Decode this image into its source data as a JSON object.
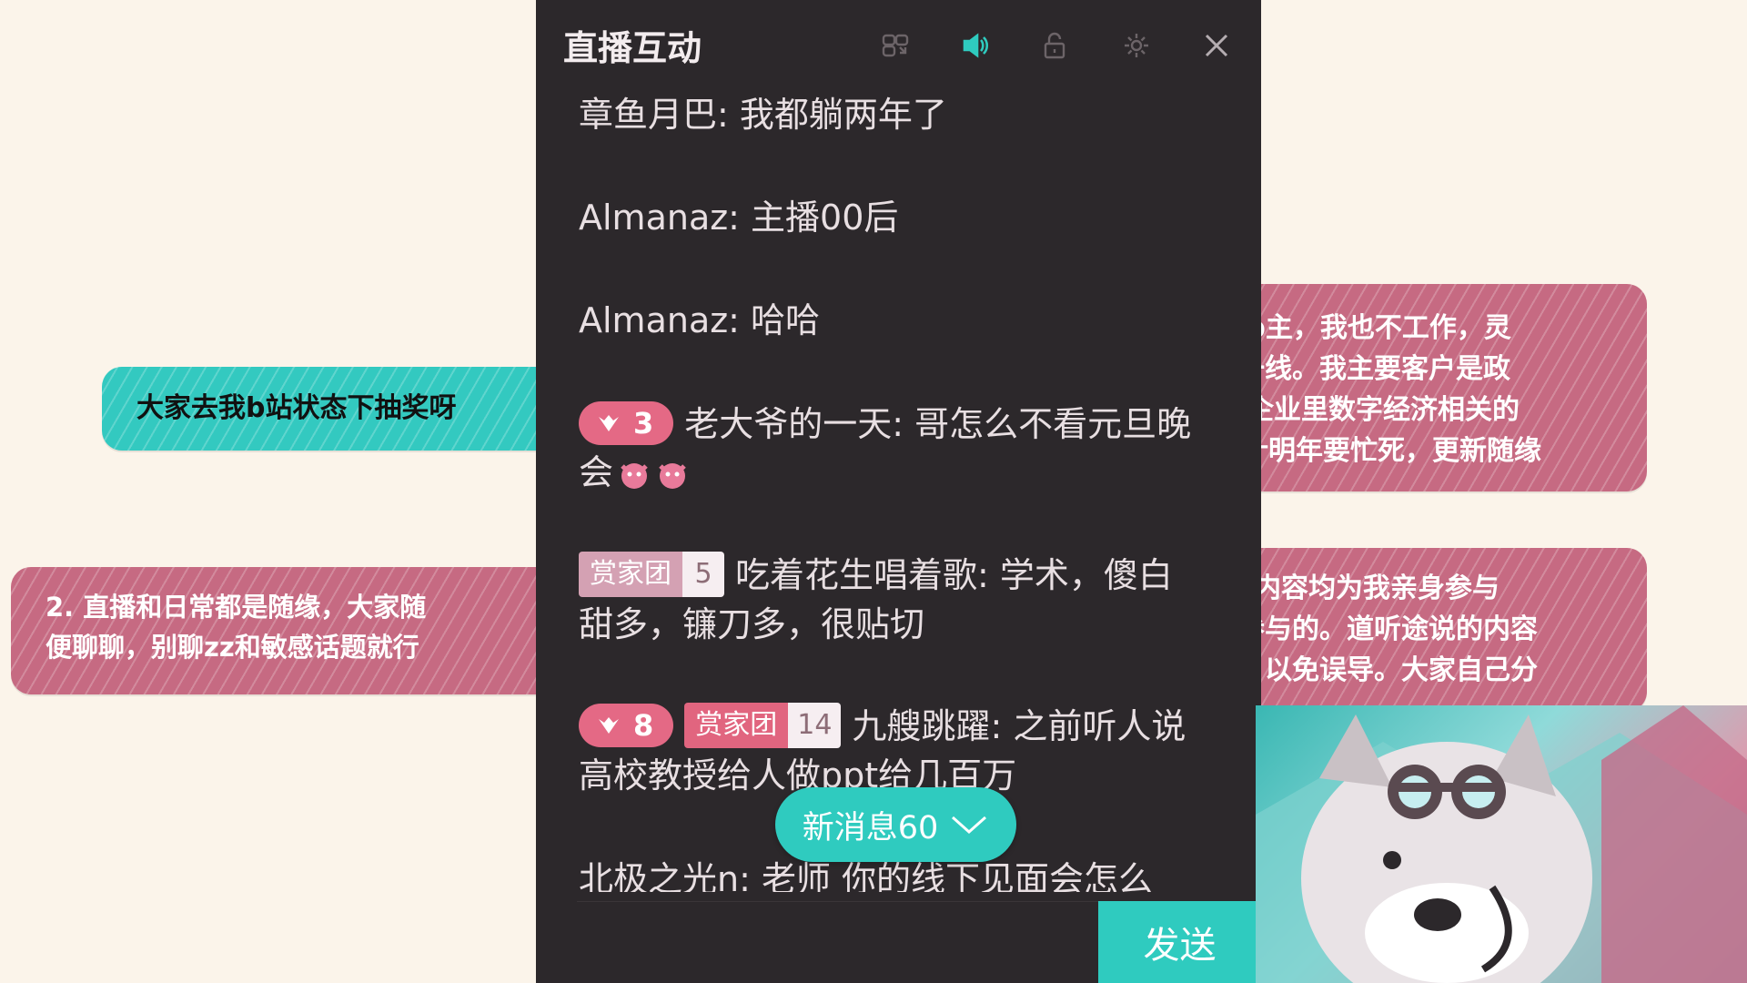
{
  "notes": {
    "teal_left": "大家去我b站状态下抽奖呀",
    "pink_left_lines": [
      "2. 直播和日常都是随缘，大家随",
      "便聊聊，别聊zz和敏感话题就行"
    ],
    "pink_right_top_lines": [
      "up主，我也不工作，灵",
      "一线。我主要客户是政",
      "企业里数字经济相关的",
      "计明年要忙死，更新随缘"
    ],
    "pink_right_bottom_lines": [
      "新内容均为我亲身参与",
      "参与的。道听途说的内容",
      "以免误导。大家自己分"
    ]
  },
  "panel": {
    "title": "直播互动",
    "toolbar": [
      "pip-icon",
      "speaker-icon",
      "lock-icon",
      "gear-icon",
      "close-icon"
    ]
  },
  "messages": [
    {
      "text": "章鱼月巴: 我都躺两年了"
    },
    {
      "text": "Almanaz: 主播00后"
    },
    {
      "text": "Almanaz: 哈哈"
    },
    {
      "guard_level": "3",
      "text": "老大爷的一天: 哥怎么不看元旦晚会"
    },
    {
      "fan_badge": "赏家团",
      "fan_level": "5",
      "text": "吃着花生唱着歌: 学术，傻白甜多，镰刀多，很贴切"
    },
    {
      "guard_level": "8",
      "fan_badge": "赏家团",
      "fan_level": "14",
      "text": "九艘跳躍: 之前听人说高校教授给人做ppt给几百万"
    },
    {
      "text": "北极之光n: 老师 你的线下见面会怎么"
    }
  ],
  "new_messages": {
    "label": "新消息60"
  },
  "send_label": "发送",
  "colors": {
    "accent": "#2fcbbf",
    "panel_bg": "#2c282b",
    "pink_note": "#c66a82",
    "teal_note": "#33c9c0"
  }
}
